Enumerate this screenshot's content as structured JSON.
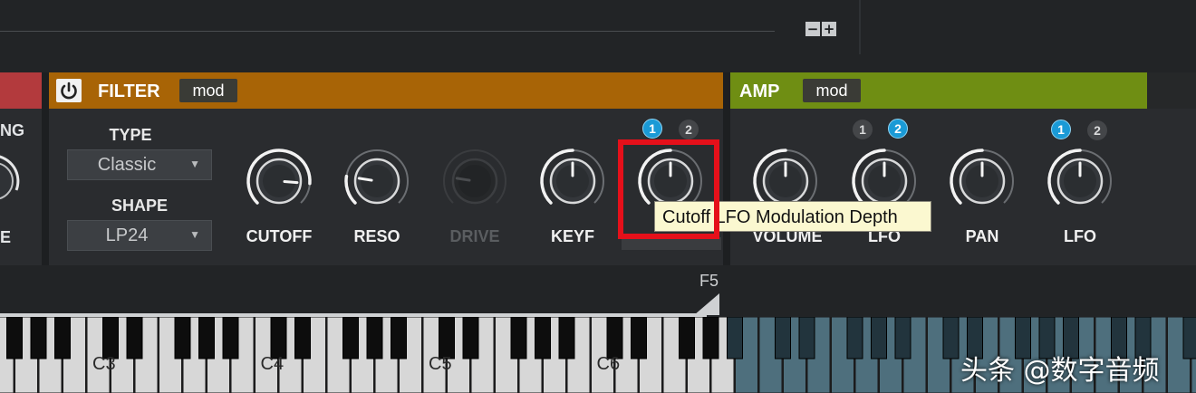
{
  "top_bar": {
    "zoom_out_label": "−",
    "zoom_in_label": "+"
  },
  "left_section": {
    "partial_label_top": "NG",
    "partial_label_bottom": "E"
  },
  "filter": {
    "title": "FILTER",
    "mod_label": "mod",
    "type_label": "TYPE",
    "type_value": "Classic",
    "shape_label": "SHAPE",
    "shape_value": "LP24",
    "knobs": [
      {
        "label": "CUTOFF",
        "level": 0.85,
        "enabled": true
      },
      {
        "label": "RESO",
        "level": 0.2,
        "enabled": true
      },
      {
        "label": "DRIVE",
        "level": 0.2,
        "enabled": false
      },
      {
        "label": "KEYF",
        "level": 0.5,
        "enabled": true
      },
      {
        "label": "",
        "level": 0.5,
        "enabled": true
      }
    ],
    "mod_badges": [
      "1",
      "2"
    ]
  },
  "amp": {
    "title": "AMP",
    "mod_label": "mod",
    "knobs": [
      {
        "label": "VOLUME",
        "level": 0.5
      },
      {
        "label": "LFO",
        "level": 0.5
      },
      {
        "label": "PAN",
        "level": 0.5
      },
      {
        "label": "LFO",
        "level": 0.5
      }
    ],
    "lfo1_badges": [
      "1",
      "2"
    ],
    "lfo2_badges": [
      "1",
      "2"
    ]
  },
  "tooltip": {
    "text": "Cutoff LFO Modulation Depth"
  },
  "keyboard": {
    "range_marker": "F5",
    "octave_labels": [
      "C3",
      "C4",
      "C5",
      "C6"
    ]
  },
  "watermark": "头条 @数字音频",
  "colors": {
    "filter_accent": "#a86406",
    "amp_accent": "#6f8e13",
    "left_accent": "#b33a3d",
    "badge_active": "#1a9ad6",
    "highlight": "#e5101a",
    "tooltip_bg": "#fbf8d0"
  }
}
